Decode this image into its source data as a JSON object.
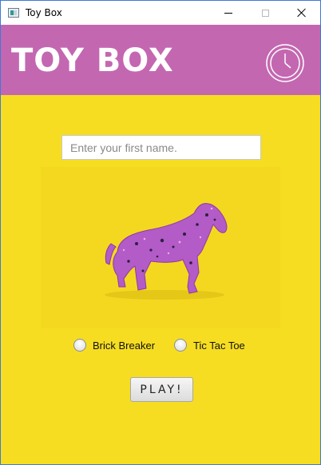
{
  "window": {
    "title": "Toy Box",
    "controls": {
      "minimize": "minimize-icon",
      "maximize": "maximize-icon",
      "close": "close-icon"
    }
  },
  "header": {
    "title": "TOY BOX",
    "icon": "clock-icon",
    "background": "#c467b1"
  },
  "form": {
    "name_placeholder": "Enter your first name.",
    "name_value": "",
    "image": "purple-glitter-toy-horse-image",
    "games": [
      {
        "label": "Brick Breaker",
        "selected": false
      },
      {
        "label": "Tic Tac Toe",
        "selected": false
      }
    ],
    "play_label": "PLAY!"
  },
  "colors": {
    "background": "#f6dd22",
    "header": "#c467b1",
    "toy": "#b25ac4"
  }
}
